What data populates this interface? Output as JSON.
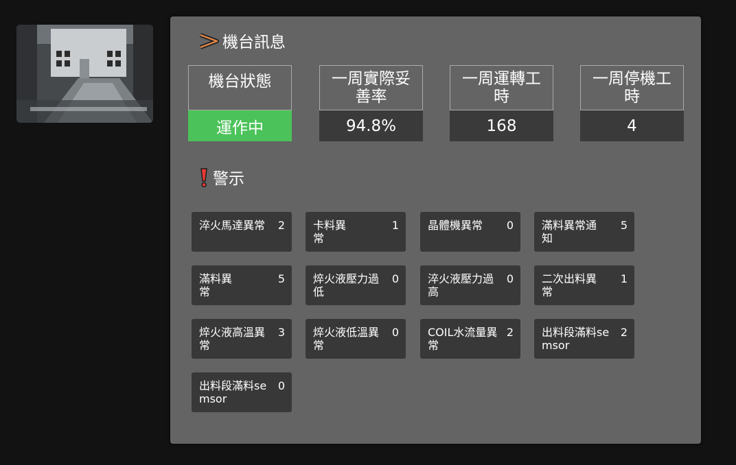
{
  "machine_info": {
    "title": "機台訊息",
    "stats": [
      {
        "label": "機台狀態",
        "value": "運作中"
      },
      {
        "label": "一周實際妥善率",
        "value": "94.8%"
      },
      {
        "label": "一周運轉工時",
        "value": "168"
      },
      {
        "label": "一周停機工時",
        "value": "4"
      }
    ]
  },
  "alerts_section": {
    "title": "警示",
    "alerts": [
      {
        "name": "淬火馬達異常",
        "count": "2"
      },
      {
        "name": "卡料異常",
        "count": "1"
      },
      {
        "name": "晶體機異常",
        "count": "0"
      },
      {
        "name": "滿料異常通知",
        "count": "5"
      },
      {
        "name": "滿料異常",
        "count": "5"
      },
      {
        "name": "焠火液壓力過低",
        "count": "0"
      },
      {
        "name": "淬火液壓力過高",
        "count": "0"
      },
      {
        "name": "二次出料異常",
        "count": "1"
      },
      {
        "name": "焠火液高溫異常",
        "count": "3"
      },
      {
        "name": "焠火液低溫異常",
        "count": "0"
      },
      {
        "name": "COIL水流量異常",
        "count": "2"
      },
      {
        "name": "出料段滿料semsor",
        "count": "2"
      },
      {
        "name": "出料段滿料semsor",
        "count": "0"
      }
    ]
  },
  "colors": {
    "page_bg": "#121212",
    "panel_bg": "#646464",
    "tile_bg": "#383838",
    "running": "#4cc35a",
    "alert_icon": "#e53935"
  },
  "icons": {
    "info": "chevron-arrow-icon",
    "warning": "exclamation-icon"
  }
}
